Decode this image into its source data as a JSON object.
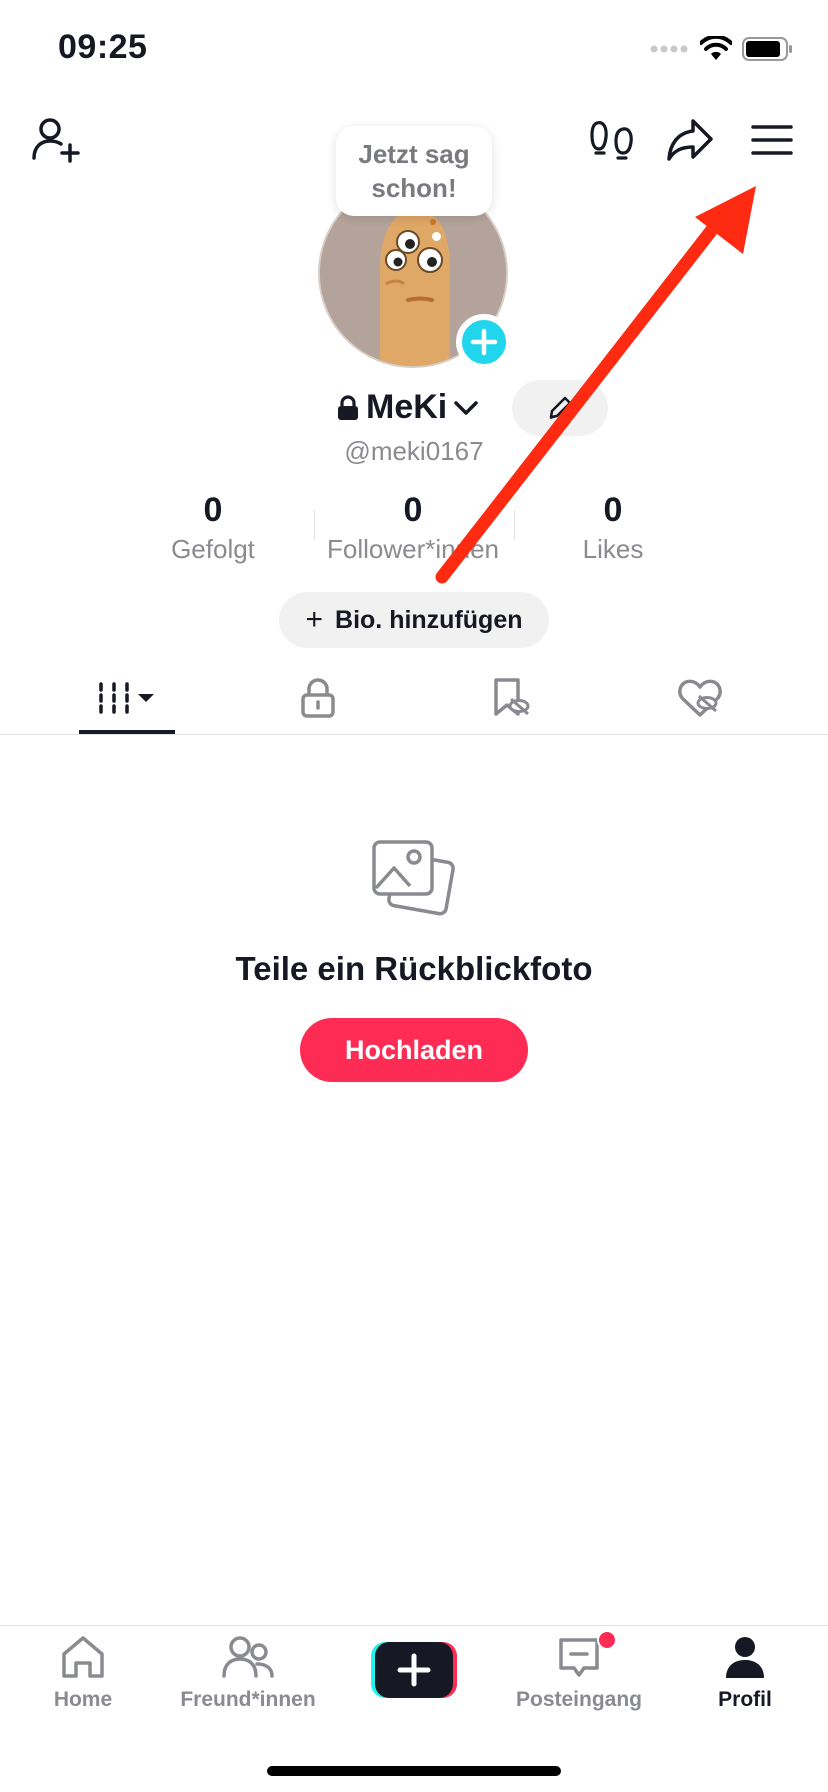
{
  "status_bar": {
    "time": "09:25"
  },
  "bubble": {
    "line1": "Jetzt sag",
    "line2": "schon!"
  },
  "profile": {
    "name": "MeKi",
    "handle": "@meki0167"
  },
  "stats": [
    {
      "value": "0",
      "label": "Gefolgt"
    },
    {
      "value": "0",
      "label": "Follower*innen"
    },
    {
      "value": "0",
      "label": "Likes"
    }
  ],
  "bio_button": {
    "label": "Bio. hinzufügen",
    "plus": "+"
  },
  "empty_state": {
    "title": "Teile ein Rückblickfoto",
    "button": "Hochladen"
  },
  "bottom_nav": [
    {
      "label": "Home",
      "icon": "home-icon"
    },
    {
      "label": "Freund*innen",
      "icon": "friends-icon"
    },
    {
      "label": "",
      "icon": "create-icon"
    },
    {
      "label": "Posteingang",
      "icon": "inbox-icon"
    },
    {
      "label": "Profil",
      "icon": "profile-icon"
    }
  ],
  "colors": {
    "accent": "#fe2c55",
    "cyan": "#20d5ec",
    "arrow": "#ff2a12"
  }
}
